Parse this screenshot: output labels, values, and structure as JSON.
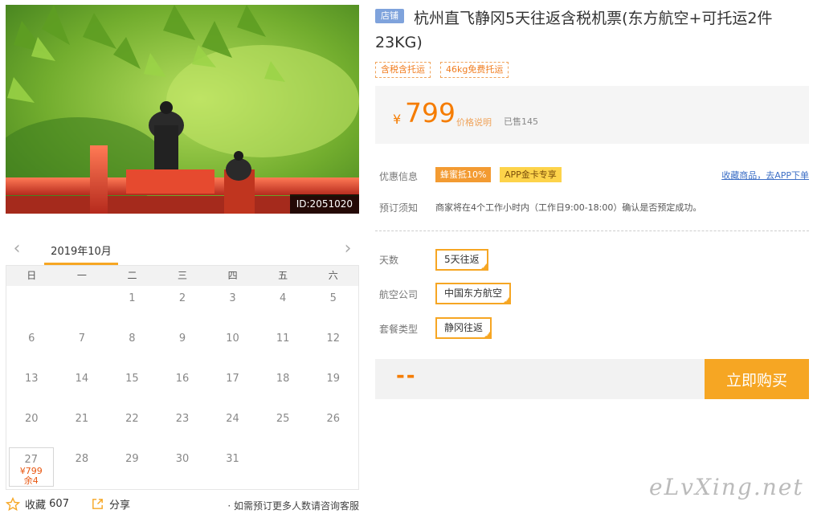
{
  "photo": {
    "id_label": "ID:2051020"
  },
  "product": {
    "shop_tag": "店铺",
    "title": "杭州直飞静冈5天往返含税机票(东方航空+可托运2件23KG)",
    "tags": [
      "含税含托运",
      "46kg免费托运"
    ]
  },
  "price": {
    "currency": "¥",
    "value": "799",
    "note": "价格说明",
    "sold": "已售145"
  },
  "promo": {
    "label": "优惠信息",
    "badge_a": "蜂蜜抵10%",
    "badge_b": "APP金卡专享",
    "app_link": "收藏商品，去APP下单"
  },
  "booking": {
    "label": "预订须知",
    "text": "商家将在4个工作小时内（工作日9:00-18:00）确认是否预定成功。"
  },
  "options": [
    {
      "label": "天数",
      "value": "5天往返"
    },
    {
      "label": "航空公司",
      "value": "中国东方航空"
    },
    {
      "label": "套餐类型",
      "value": "静冈往返"
    }
  ],
  "purchase": {
    "total": "--",
    "buy_label": "立即购买"
  },
  "calendar": {
    "month": "2019年10月",
    "prev": "‹",
    "next": "›",
    "weekdays": [
      "日",
      "一",
      "二",
      "三",
      "四",
      "五",
      "六"
    ],
    "leading_blanks": 2,
    "days": 31,
    "available": [
      {
        "day": 27,
        "price": "¥799",
        "stock": "余4"
      }
    ]
  },
  "footer": {
    "favorite_label": "收藏",
    "favorite_count": "607",
    "share_label": "分享",
    "consult": "· 如需预订更多人数请咨询客服"
  },
  "watermark": "eLvXing.net",
  "colors": {
    "accent": "#f6a623",
    "price": "#f57c00",
    "link": "#3d6fc6"
  }
}
